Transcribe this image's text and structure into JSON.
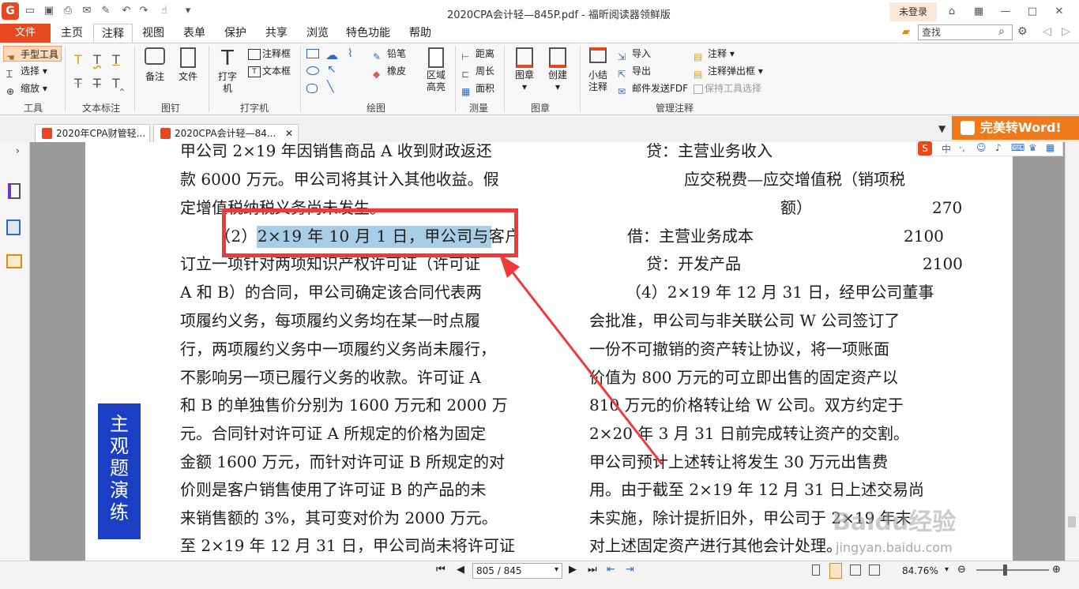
{
  "title_bar": {
    "title": "2020CPA会计轻—845P.pdf - 福昕阅读器领鲜版",
    "login": "未登录",
    "app_logo": "G"
  },
  "menu": {
    "file": "文件",
    "tabs": [
      "主页",
      "注释",
      "视图",
      "表单",
      "保护",
      "共享",
      "浏览",
      "特色功能",
      "帮助"
    ],
    "search_placeholder": "查找"
  },
  "ribbon": {
    "tools": {
      "hand": "手型工具",
      "select": "选择",
      "zoom": "缩放",
      "group": "工具"
    },
    "text_markup": {
      "group": "文本标注"
    },
    "pin": {
      "note": "备注",
      "file": "文件",
      "group": "图钉"
    },
    "typewriter": {
      "typewriter": "打字机",
      "callout": "注释框",
      "textbox": "文本框",
      "group": "打字机"
    },
    "drawing": {
      "pencil": "铅笔",
      "eraser": "橡皮",
      "area_highlight": "区域高亮",
      "group": "绘图"
    },
    "measure": {
      "distance": "距离",
      "perimeter": "周长",
      "area": "面积",
      "group": "测量"
    },
    "stamp": {
      "stamp": "图章",
      "create": "创建",
      "group": "图章"
    },
    "manage": {
      "summary": "小结注释",
      "import": "导入",
      "export": "导出",
      "email": "邮件发送FDF",
      "annot": "注释",
      "popup": "注释弹出框",
      "keep_tool": "保持工具选择",
      "group": "管理注释"
    }
  },
  "doc_tabs": [
    "2020年CPA财管轻...",
    "2020CPA会计轻—84..."
  ],
  "to_word": "完美转Word!",
  "document": {
    "left_lines": [
      "甲公司 2×19 年因销售商品 A 收到财政返还",
      "款 6000 万元。甲公司将其计入其他收益。假",
      "定增值税纳税义务尚未发生。",
      "（2）2×19 年 10 月 1 日，甲公司与客户",
      "订立一项针对两项知识产权许可证（许可证",
      "A 和 B）的合同，甲公司确定该合同代表两",
      "项履约义务，每项履约义务均在某一时点履",
      "行，两项履约义务中一项履约义务尚未履行，",
      "不影响另一项已履行义务的收款。许可证 A",
      "和 B 的单独售价分别为 1600 万元和 2000 万",
      "元。合同针对许可证 A 所规定的价格为固定",
      "金额 1600 万元，而针对许可证 B 所规定的对",
      "价则是客户销售使用了许可证 B 的产品的未",
      "来销售额的 3%，其可变对价为 2000 万元。",
      "至 2×19 年 12 月 31 日，甲公司尚未将许可证"
    ],
    "highlighted": "2×19 年 10 月 1 日，甲公司",
    "right_lines": [
      "贷：主营业务收入",
      "应交税费—应交增值税（销项税",
      "额）",
      "借：主营业务成本",
      "贷：开发产品",
      "（4）2×19 年 12 月 31 日，经甲公司董事",
      "会批准，甲公司与非关联公司 W 公司签订了",
      "一份不可撤销的资产转让协议，将一项账面",
      "价值为 800 万元的可立即出售的固定资产以",
      "810 万元的价格转让给 W 公司。双方约定于",
      "2×20 年 3 月 31 日前完成转让资产的交割。",
      "甲公司预计上述转让将发生 30 万元出售费",
      "用。由于截至 2×19 年 12 月 31 日上述交易尚",
      "未实施，除计提折旧外，甲公司于 2×19 年末",
      "对上述固定资产进行其他会计处理。"
    ],
    "right_amounts": [
      "270",
      "2100",
      "2100"
    ],
    "badge": "主观题演练"
  },
  "status": {
    "page": "805 / 845",
    "zoom": "84.76%"
  },
  "watermark": {
    "brand": "Baidu经验",
    "url": "jingyan.baidu.com"
  },
  "colors": {
    "accent": "#e8481f",
    "highlight": "#a9cde6",
    "annotation": "#f03a3a",
    "badge": "#1b3fc4",
    "to_word": "#f07a1a"
  }
}
